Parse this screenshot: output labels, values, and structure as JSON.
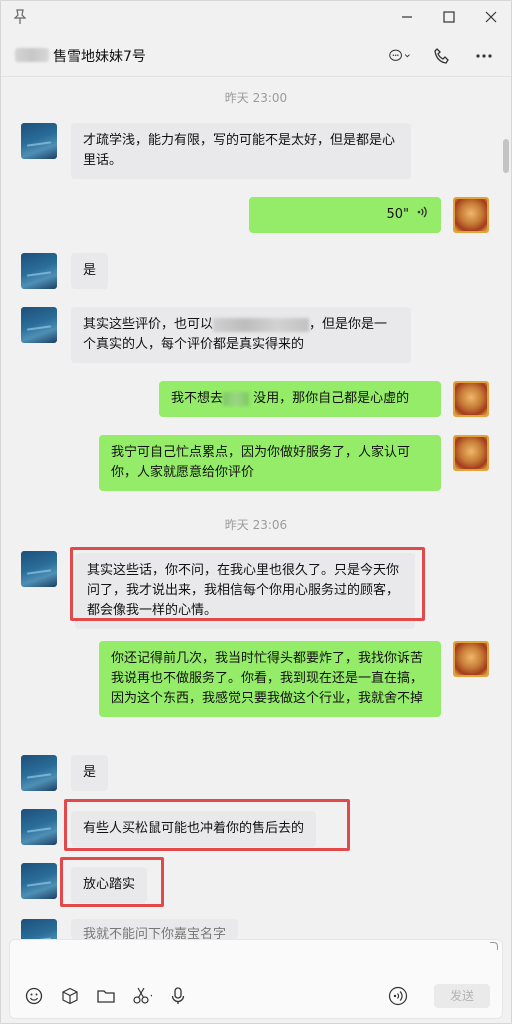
{
  "titlebar": {
    "icons": [
      "pin-icon",
      "minimize-icon",
      "maximize-icon",
      "close-icon"
    ]
  },
  "chat": {
    "title": "售雪地妹妹7号"
  },
  "messages": {
    "time1": "昨天 23:00",
    "m1": "才疏学浅，能力有限，写的可能不是太好，但是都是心里话。",
    "m2_duration": "50\"",
    "m3": "是",
    "m4_a": "其实这些评价，也可以",
    "m4_b": "，但是你是一个真实的人，每个评价都是真实得来的",
    "m5_a": "我不想去",
    "m5_b": "没用，那你自己都是心虚的",
    "m6": "我宁可自己忙点累点，因为你做好服务了，人家认可你，人家就愿意给你评价",
    "time2": "昨天 23:06",
    "m7": "其实这些话，你不问，在我心里也很久了。只是今天你问了，我才说出来，我相信每个你用心服务过的顾客，都会像我一样的心情。",
    "m8": "你还记得前几次，我当时忙得头都要炸了，我找你诉苦　我说再也不做服务了。你看，我到现在还是一直在搞，因为这个东西，我感觉只要我做这个行业，我就舍不掉",
    "m9": "是",
    "m10": "有些人买松鼠可能也冲着你的售后去的",
    "m11": "放心踏实",
    "m12_partial": "我就不能问下你嘉宝名字"
  },
  "input": {
    "send_label": "发送"
  },
  "colors": {
    "bubble_self": "#95ec69",
    "bubble_other": "#e9e9eb",
    "highlight": "#e2494b"
  }
}
